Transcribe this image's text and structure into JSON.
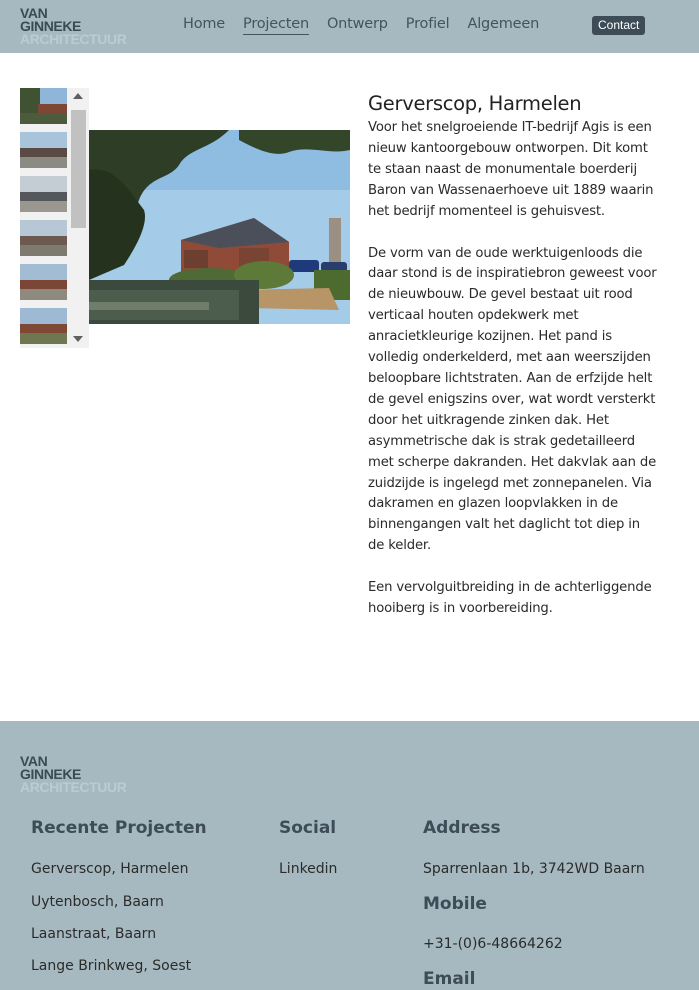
{
  "brand": {
    "line1": "VAN",
    "line2": "GINNEKE",
    "line3": "ARCHITECTUUR"
  },
  "nav": {
    "items": [
      "Home",
      "Projecten",
      "Ontwerp",
      "Profiel",
      "Algemeen"
    ],
    "active": "Projecten",
    "contact_label": "Contact"
  },
  "colors": {
    "header_bg": "#a6b9c1",
    "footer_bg": "#a6b9c1",
    "heading_dark": "#3d4c57",
    "contact_bg": "#3d4c57"
  },
  "project": {
    "title": "Gerverscop, Harmelen",
    "paragraphs": [
      "Voor het snelgroeiende IT-bedrijf Agis is een nieuw kantoorgebouw ontworpen. Dit komt te staan naast de monumentale boerderij Baron van Wassenaerhoeve uit 1889 waarin het bedrijf momenteel is gehuisvest.",
      "De vorm van de oude werktuigenloods die daar stond is de inspiratiebron geweest voor de nieuwbouw. De gevel bestaat uit rood verticaal houten opdekwerk met anracietkleurige kozijnen. Het pand is volledig onderkelderd, met aan weerszijden beloopbare lichtstraten. Aan de erfzijde helt de gevel enigszins over, wat wordt versterkt door het uitkragende zinken dak. Het asymmetrische dak is strak gedetailleerd met scherpe dakranden. Het dakvlak aan de zuidzijde is ingelegd met zonnepanelen. Via dakramen en glazen loopvlakken in de binnengangen valt het daglicht tot diep in de kelder.",
      "Een vervolguitbreiding in de achterliggende hooiberg is in voorbereiding."
    ],
    "main_photo": "project-photo"
  },
  "thumbnails": [
    {
      "icon": "thumbnail-photo-1"
    },
    {
      "icon": "thumbnail-photo-2"
    },
    {
      "icon": "thumbnail-photo-3"
    },
    {
      "icon": "thumbnail-photo-4"
    },
    {
      "icon": "thumbnail-photo-5"
    },
    {
      "icon": "thumbnail-photo-6"
    }
  ],
  "footer": {
    "recent": {
      "heading": "Recente Projecten",
      "items": [
        "Gerverscop, Harmelen",
        "Uytenbosch, Baarn",
        "Laanstraat, Baarn",
        "Lange Brinkweg, Soest"
      ]
    },
    "social": {
      "heading": "Social",
      "items": [
        "Linkedin"
      ]
    },
    "address": {
      "heading": "Address",
      "value": "Sparrenlaan 1b, 3742WD Baarn"
    },
    "mobile": {
      "heading": "Mobile",
      "value": "+31-(0)6-48664262"
    },
    "email": {
      "heading": "Email"
    }
  }
}
